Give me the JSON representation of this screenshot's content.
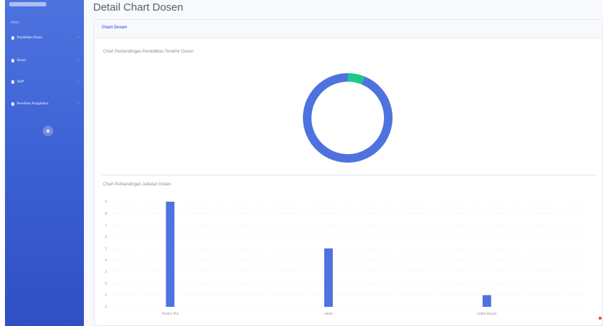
{
  "page": {
    "title": "Detail Chart Dosen"
  },
  "sidebar": {
    "heading": "MENU",
    "items": [
      {
        "label": "Pendidikan Dosen",
        "icon": "folder-icon"
      },
      {
        "label": "Dosen",
        "icon": "user-icon"
      },
      {
        "label": "Staff",
        "icon": "users-icon"
      },
      {
        "label": "Penelitian Pengabdian",
        "icon": "book-icon"
      }
    ]
  },
  "card": {
    "header": "Chart Dosen",
    "donut_title": "Chart Perbandingan Pendidikan Terakhir Dosen",
    "bar_title": "Chart Perbandingan Jabatan Dosen"
  },
  "colors": {
    "primary": "#4e73df",
    "success": "#1cc88a"
  },
  "chart_data": [
    {
      "type": "pie",
      "variant": "donut",
      "title": "Chart Perbandingan Pendidikan Terakhir Dosen",
      "slices": [
        {
          "value": 15,
          "color": "#4e73df"
        },
        {
          "value": 1,
          "color": "#1cc88a"
        }
      ]
    },
    {
      "type": "bar",
      "title": "Chart Perbandingan Jabatan Dosen",
      "categories": [
        "Asisten Ahli",
        "Lektor",
        "Lektor Kepala"
      ],
      "values": [
        9,
        5,
        1
      ],
      "ylim": [
        0,
        9
      ],
      "yticks": [
        "0",
        "1",
        "2",
        "3",
        "4",
        "5",
        "6",
        "7",
        "8",
        "9"
      ],
      "color": "#4e73df",
      "grid": true
    }
  ]
}
